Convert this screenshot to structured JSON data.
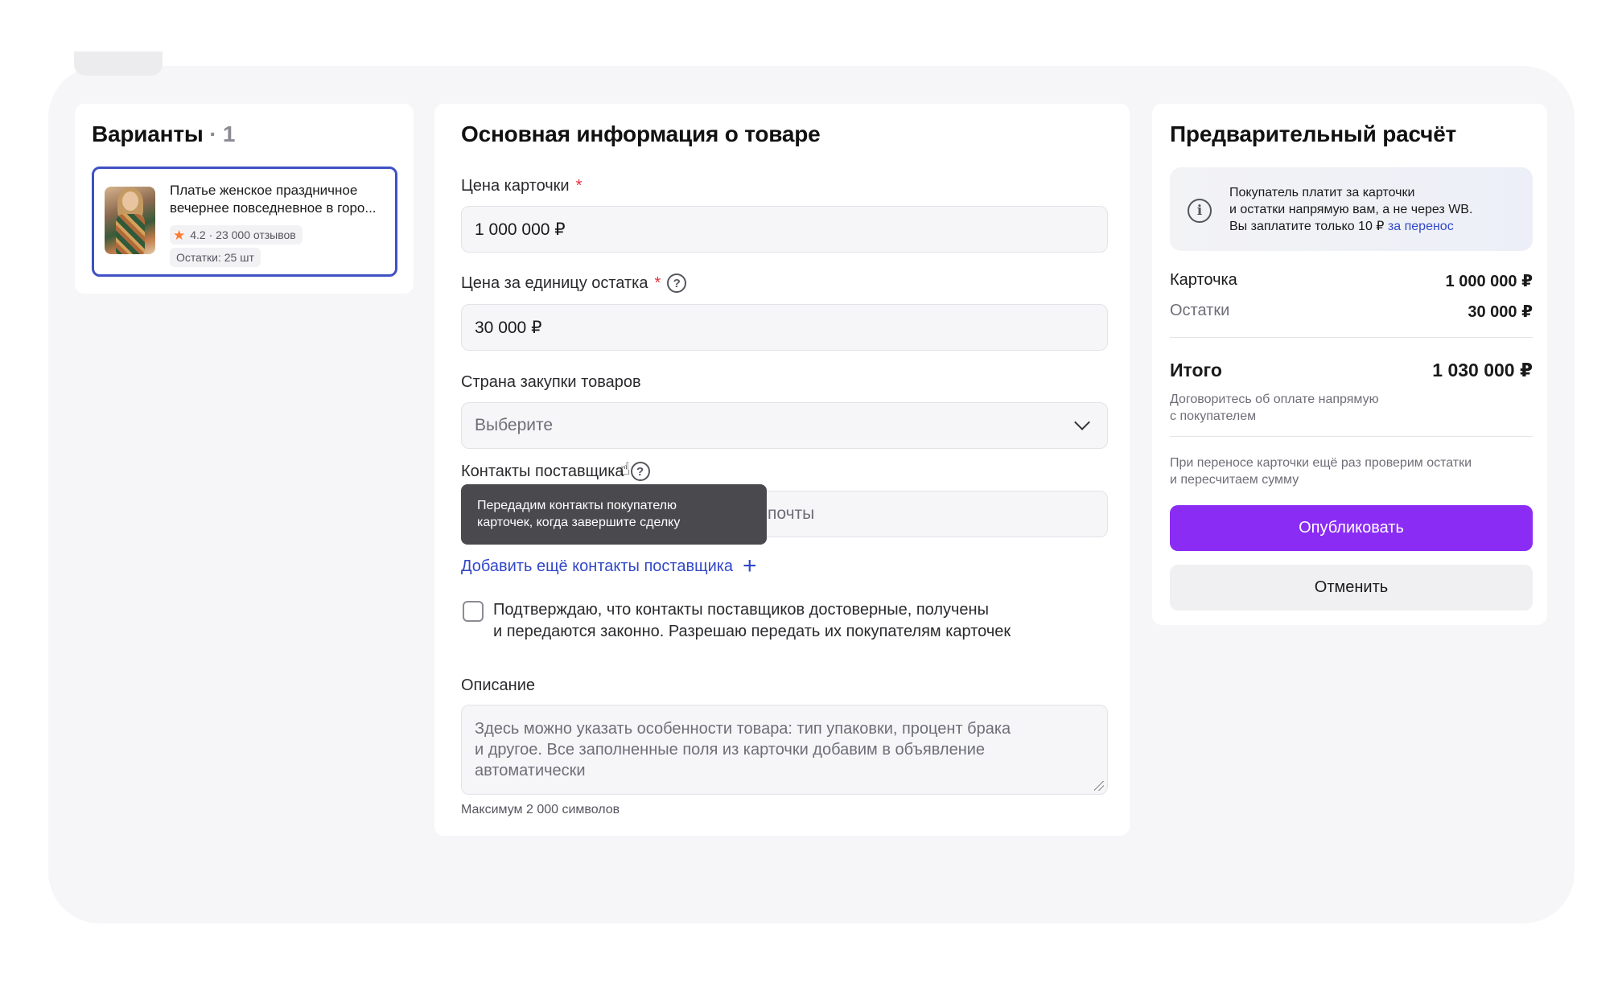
{
  "variants": {
    "title": "Варианты",
    "count": "· 1",
    "item": {
      "name_line1": "Платье женское праздничное",
      "name_line2": "вечернее повседневное в горо...",
      "rating": "4.2 · 23 000 отзывов",
      "stock": "Остатки: 25 шт"
    }
  },
  "main": {
    "title": "Основная информация о товаре",
    "card_price": {
      "label": "Цена карточки",
      "required": "*",
      "value": "1 000 000 ₽"
    },
    "unit_price": {
      "label": "Цена за единицу остатка",
      "required": "*",
      "value": "30 000 ₽"
    },
    "country": {
      "label": "Страна закупки товаров",
      "placeholder": "Выберите"
    },
    "supplier": {
      "label": "Контакты поставщика",
      "placeholder_visible": "почты"
    },
    "tooltip": {
      "line1": "Передадим контакты покупателю",
      "line2": "карточек, когда завершите сделку"
    },
    "add_contacts": "Добавить ещё контакты поставщика",
    "consent_line1": "Подтверждаю, что контакты поставщиков достоверные, получены",
    "consent_line2": "и передаются законно. Разрешаю передать их покупателям карточек",
    "description": {
      "label": "Описание",
      "placeholder_line1": "Здесь можно указать особенности товара: тип упаковки, процент брака",
      "placeholder_line2": "и другое. Все заполненные поля из карточки добавим в объявление",
      "placeholder_line3": "автоматически",
      "hint": "Максимум 2 000 символов"
    },
    "help_glyph": "?"
  },
  "calc": {
    "title": "Предварительный расчёт",
    "info": {
      "line1": "Покупатель платит за карточки",
      "line2": "и остатки напрямую вам, а не через WB.",
      "line3_prefix": "Вы заплатите только 10 ₽ ",
      "line3_link": "за перенос",
      "icon_glyph": "i"
    },
    "card_label": "Карточка",
    "card_value": "1 000 000 ₽",
    "stock_label": "Остатки",
    "stock_value": "30 000 ₽",
    "total_label": "Итого",
    "total_value": "1 030 000 ₽",
    "total_note_line1": "Договоритесь об оплате напрямую",
    "total_note_line2": "с покупателем",
    "transfer_note_line1": "При переносе карточки ещё раз проверим остатки",
    "transfer_note_line2": "и пересчитаем сумму",
    "publish_label": "Опубликовать",
    "cancel_label": "Отменить"
  },
  "colors": {
    "accent": "#8b2cf5",
    "link": "#3248c8",
    "selected_border": "#3f51c4",
    "required": "#e5303b",
    "star": "#ff7a2e"
  }
}
